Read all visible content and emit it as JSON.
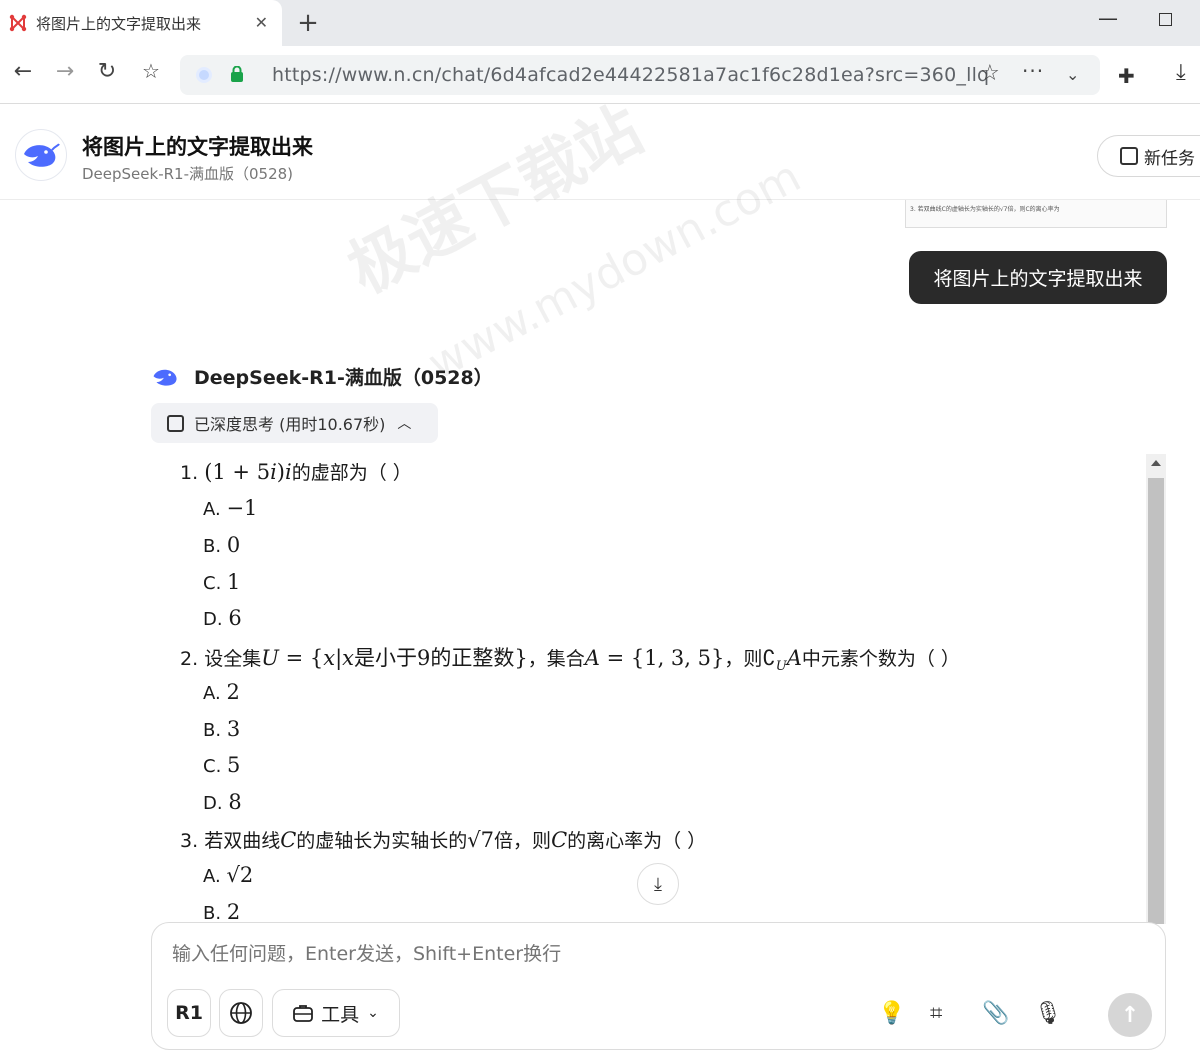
{
  "browser": {
    "tab_title": "将图片上的文字提取出来",
    "new_tab": "+",
    "url_host": "https://www.n.cn",
    "url_path": "/chat/6d4afcad2e44422581a7ac1f6c28d1ea?src=360_llq"
  },
  "header": {
    "title": "将图片上的文字提取出来",
    "model": "DeepSeek-R1-满血版（0528)",
    "new_task": "新任务"
  },
  "thumb_text": "3. 若双曲线C的虚轴长为实轴长的√7倍，则C的离心率为",
  "user_message": "将图片上的文字提取出来",
  "bot": {
    "name": "DeepSeek-R1-满血版（0528）",
    "thinking": "已深度思考 (用时10.67秒)"
  },
  "questions": {
    "q1": {
      "num": "1.",
      "expr": "(1 + 5",
      "i1": "i",
      "close": ")",
      "i2": "i",
      "text": "的虚部为（ ）",
      "opts": [
        {
          "label": "A.",
          "value": "−1"
        },
        {
          "label": "B.",
          "value": "0"
        },
        {
          "label": "C.",
          "value": "1"
        },
        {
          "label": "D.",
          "value": "6"
        }
      ]
    },
    "q2": {
      "num": "2.",
      "text1": "设全集",
      "U": "U",
      "eq1": " = {",
      "x1": "x",
      "bar": "|",
      "x2": "x",
      "setdesc": "是小于9的正整数}",
      "text2": "，集合",
      "A": "A",
      "eq2": " = {1, 3, 5}",
      "text3": "，则",
      "comp": "∁",
      "sub": "U",
      "A2": "A",
      "text4": "中元素个数为（ ）",
      "opts": [
        {
          "label": "A.",
          "value": "2"
        },
        {
          "label": "B.",
          "value": "3"
        },
        {
          "label": "C.",
          "value": "5"
        },
        {
          "label": "D.",
          "value": "8"
        }
      ]
    },
    "q3": {
      "num": "3.",
      "text1": "若双曲线",
      "C": "C",
      "text2": "的虚轴长为实轴长的",
      "sqrt": "√7",
      "text3": "倍，则",
      "C2": "C",
      "text4": "的离心率为（ ）",
      "opts": [
        {
          "label": "A.",
          "value": "√2"
        },
        {
          "label": "B.",
          "value": "2"
        }
      ]
    }
  },
  "composer": {
    "placeholder": "输入任何问题，Enter发送，Shift+Enter换行",
    "r1": "R1",
    "tools": "工具"
  },
  "watermark": {
    "line1": "极速下载站",
    "line2": "www.mydown.com"
  }
}
